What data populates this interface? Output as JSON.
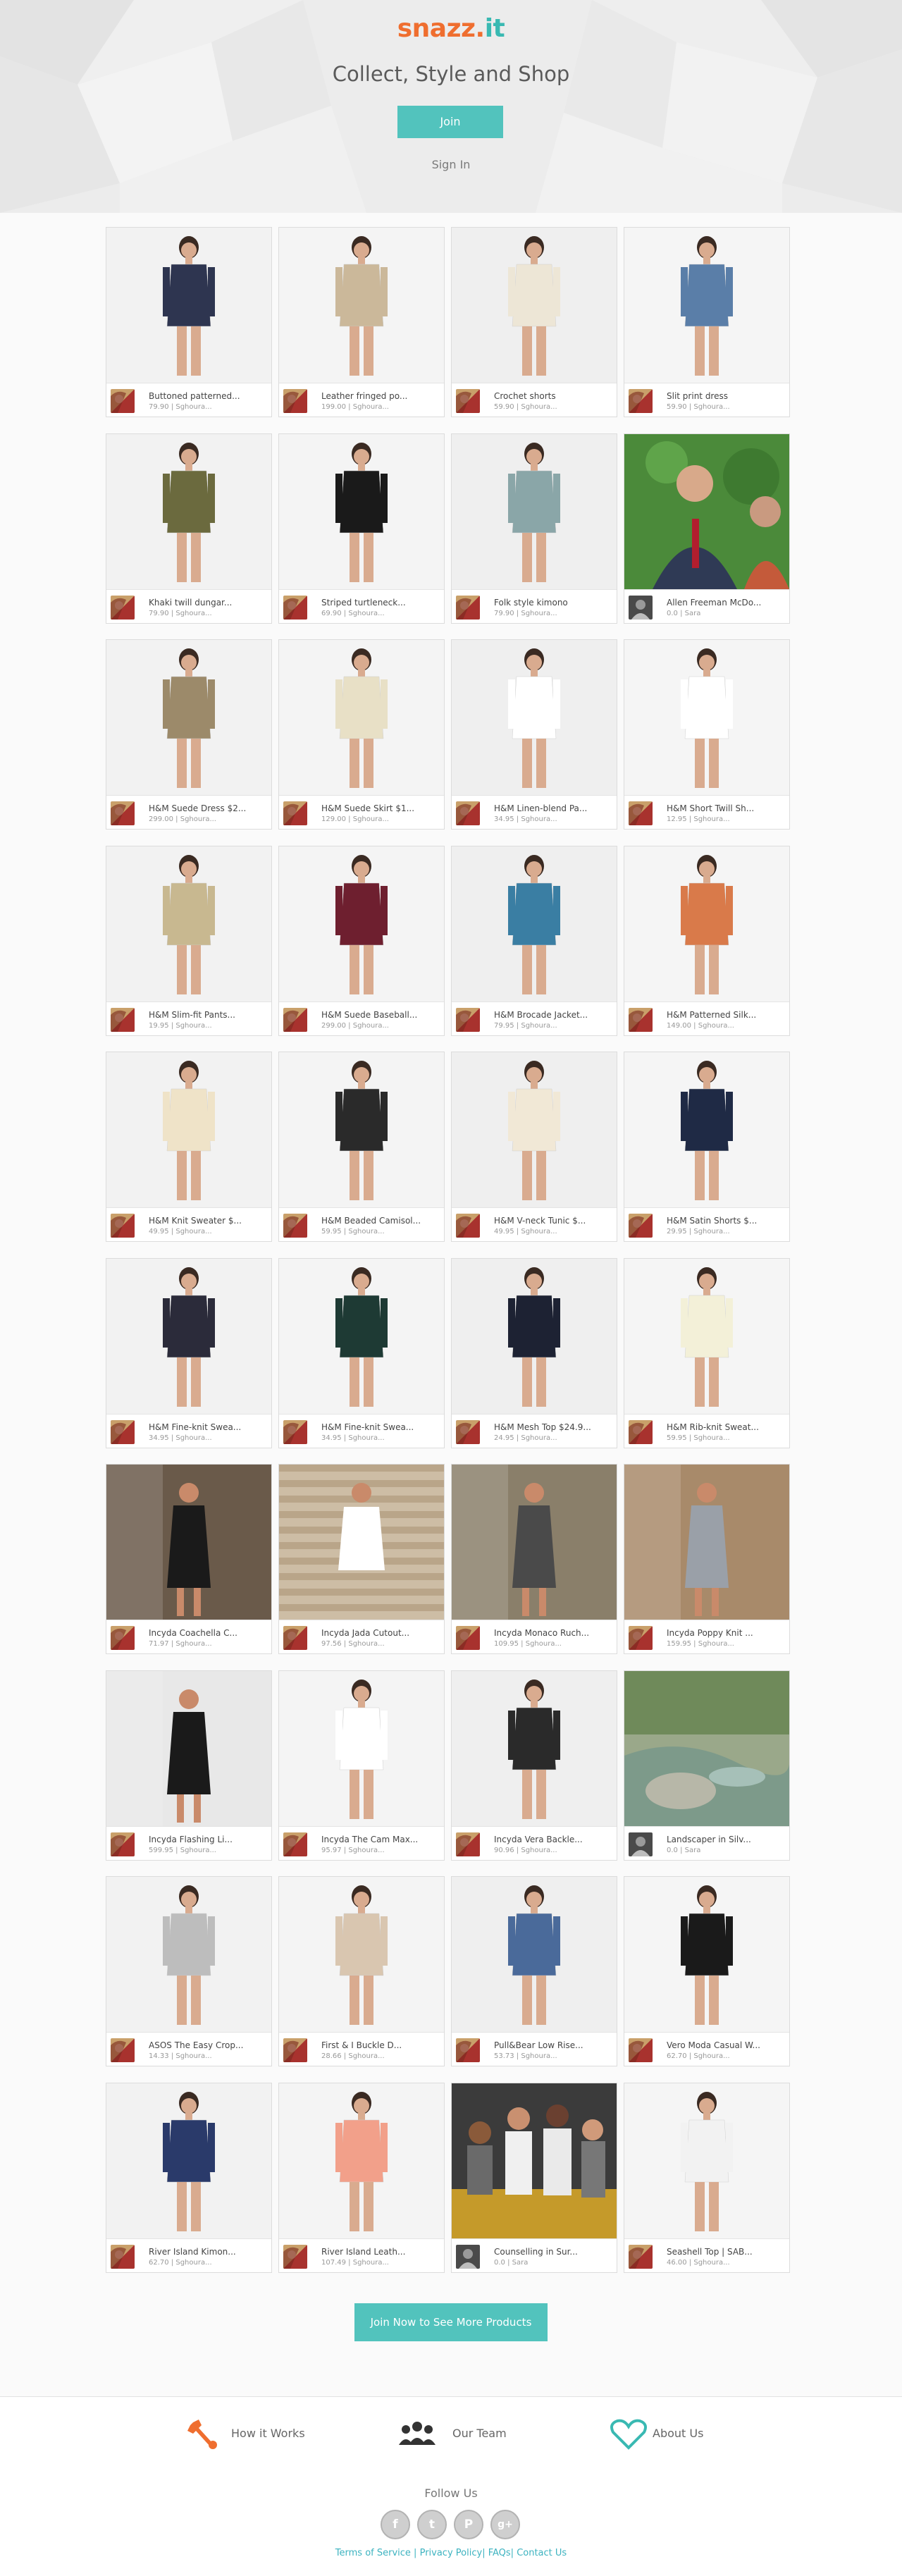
{
  "hero": {
    "logo_part1": "snazz.",
    "logo_part2": "it",
    "tagline": "Collect, Style and Shop",
    "join_label": "Join",
    "signin_label": "Sign In"
  },
  "products": [
    {
      "title": "Buttoned patterned...",
      "sub": "79.90 | Sghoura..."
    },
    {
      "title": "Leather fringed po...",
      "sub": "199.00 | Sghoura..."
    },
    {
      "title": "Crochet shorts",
      "sub": "59.90 | Sghoura..."
    },
    {
      "title": "Slit print dress",
      "sub": "59.90 | Sghoura..."
    },
    {
      "title": "Khaki twill dungar...",
      "sub": "79.90 | Sghoura..."
    },
    {
      "title": "Striped turtleneck...",
      "sub": "69.90 | Sghoura..."
    },
    {
      "title": "Folk style kimono",
      "sub": "79.90 | Sghoura..."
    },
    {
      "title": "Allen Freeman McDo...",
      "sub": "0.0 | Sara"
    },
    {
      "title": "H&M Suede Dress $2...",
      "sub": "299.00 | Sghoura..."
    },
    {
      "title": "H&M Suede Skirt $1...",
      "sub": "129.00 | Sghoura..."
    },
    {
      "title": "H&M Linen-blend Pa...",
      "sub": "34.95 | Sghoura..."
    },
    {
      "title": "H&M Short Twill Sh...",
      "sub": "12.95 | Sghoura..."
    },
    {
      "title": "H&M Slim-fit Pants...",
      "sub": "19.95 | Sghoura..."
    },
    {
      "title": "H&M Suede Baseball...",
      "sub": "299.00 | Sghoura..."
    },
    {
      "title": "H&M Brocade Jacket...",
      "sub": "79.95 | Sghoura..."
    },
    {
      "title": "H&M Patterned Silk...",
      "sub": "149.00 | Sghoura..."
    },
    {
      "title": "H&M Knit Sweater $...",
      "sub": "49.95 | Sghoura..."
    },
    {
      "title": "H&M Beaded Camisol...",
      "sub": "59.95 | Sghoura..."
    },
    {
      "title": "H&M V-neck Tunic $...",
      "sub": "49.95 | Sghoura..."
    },
    {
      "title": "H&M Satin Shorts $...",
      "sub": "29.95 | Sghoura..."
    },
    {
      "title": "H&M Fine-knit Swea...",
      "sub": "34.95 | Sghoura..."
    },
    {
      "title": "H&M Fine-knit Swea...",
      "sub": "34.95 | Sghoura..."
    },
    {
      "title": "H&M Mesh Top $24.9...",
      "sub": "24.95 | Sghoura..."
    },
    {
      "title": "H&M Rib-knit Sweat...",
      "sub": "59.95 | Sghoura..."
    },
    {
      "title": "Incyda Coachella C...",
      "sub": "71.97 | Sghoura..."
    },
    {
      "title": "Incyda Jada Cutout...",
      "sub": "97.56 | Sghoura..."
    },
    {
      "title": "Incyda Monaco Ruch...",
      "sub": "109.95 | Sghoura..."
    },
    {
      "title": "Incyda Poppy Knit ...",
      "sub": "159.95 | Sghoura..."
    },
    {
      "title": "Incyda Flashing Li...",
      "sub": "599.95 | Sghoura..."
    },
    {
      "title": "Incyda The Cam Max...",
      "sub": "95.97 | Sghoura..."
    },
    {
      "title": "Incyda Vera Backle...",
      "sub": "90.96 | Sghoura..."
    },
    {
      "title": "Landscaper in Silv...",
      "sub": "0.0 | Sara"
    },
    {
      "title": "ASOS The Easy Crop...",
      "sub": "14.33 | Sghoura..."
    },
    {
      "title": "First & I Buckle D...",
      "sub": "28.66 | Sghoura..."
    },
    {
      "title": "Pull&Bear Low Rise...",
      "sub": "53.73 | Sghoura..."
    },
    {
      "title": "Vero Moda Casual W...",
      "sub": "62.70 | Sghoura..."
    },
    {
      "title": "River Island Kimon...",
      "sub": "62.70 | Sghoura..."
    },
    {
      "title": "River Island Leath...",
      "sub": "107.49 | Sghoura..."
    },
    {
      "title": "Counselling in Sur...",
      "sub": "0.0 | Sara"
    },
    {
      "title": "Seashell Top | SAB...",
      "sub": "46.00 | Sghoura..."
    }
  ],
  "more_label": "Join Now to See More Products",
  "footer": {
    "how_it_works": "How it Works",
    "our_team": "Our Team",
    "about_us": "About Us",
    "follow_us": "Follow Us",
    "social": {
      "facebook": "f",
      "twitter": "t",
      "pinterest": "P",
      "gplus": "g+"
    },
    "terms": "Terms of Service",
    "privacy": "Privacy Policy",
    "faqs": "FAQs",
    "contact": "Contact Us"
  },
  "colors": {
    "brand_orange": "#ef6e2f",
    "brand_teal": "#39b9b2",
    "button_teal": "#52c3bd",
    "link_teal": "#3db3c0"
  }
}
